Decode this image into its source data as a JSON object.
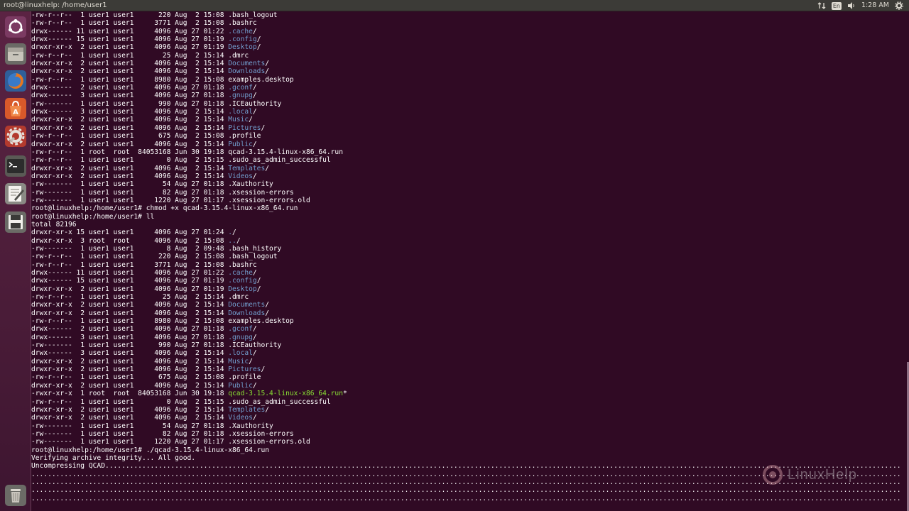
{
  "window": {
    "title": "root@linuxhelp: /home/user1"
  },
  "tray": {
    "language": "En",
    "time": "1:28 AM"
  },
  "launcher": {
    "items": [
      {
        "name": "dash-icon"
      },
      {
        "name": "files-icon"
      },
      {
        "name": "firefox-icon"
      },
      {
        "name": "software-center-icon"
      },
      {
        "name": "settings-icon"
      },
      {
        "name": "terminal-icon"
      },
      {
        "name": "text-editor-icon"
      },
      {
        "name": "save-disk-icon"
      },
      {
        "name": "trash-icon"
      }
    ]
  },
  "terminal": {
    "lines": [
      [
        {
          "t": "-rw-r--r--  1 user1 user1      220 Aug  2 15:08 .bash_logout"
        }
      ],
      [
        {
          "t": "-rw-r--r--  1 user1 user1     3771 Aug  2 15:08 .bashrc"
        }
      ],
      [
        {
          "t": "drwx------ 11 user1 user1     4096 Aug 27 01:22 "
        },
        {
          "t": ".cache",
          "c": "dir"
        },
        {
          "t": "/"
        }
      ],
      [
        {
          "t": "drwx------ 15 user1 user1     4096 Aug 27 01:19 "
        },
        {
          "t": ".config",
          "c": "dir"
        },
        {
          "t": "/"
        }
      ],
      [
        {
          "t": "drwxr-xr-x  2 user1 user1     4096 Aug 27 01:19 "
        },
        {
          "t": "Desktop",
          "c": "dir"
        },
        {
          "t": "/"
        }
      ],
      [
        {
          "t": "-rw-r--r--  1 user1 user1       25 Aug  2 15:14 .dmrc"
        }
      ],
      [
        {
          "t": "drwxr-xr-x  2 user1 user1     4096 Aug  2 15:14 "
        },
        {
          "t": "Documents",
          "c": "dir"
        },
        {
          "t": "/"
        }
      ],
      [
        {
          "t": "drwxr-xr-x  2 user1 user1     4096 Aug  2 15:14 "
        },
        {
          "t": "Downloads",
          "c": "dir"
        },
        {
          "t": "/"
        }
      ],
      [
        {
          "t": "-rw-r--r--  1 user1 user1     8980 Aug  2 15:08 examples.desktop"
        }
      ],
      [
        {
          "t": "drwx------  2 user1 user1     4096 Aug 27 01:18 "
        },
        {
          "t": ".gconf",
          "c": "dir"
        },
        {
          "t": "/"
        }
      ],
      [
        {
          "t": "drwx------  3 user1 user1     4096 Aug 27 01:18 "
        },
        {
          "t": ".gnupg",
          "c": "dir"
        },
        {
          "t": "/"
        }
      ],
      [
        {
          "t": "-rw-------  1 user1 user1      990 Aug 27 01:18 .ICEauthority"
        }
      ],
      [
        {
          "t": "drwx------  3 user1 user1     4096 Aug  2 15:14 "
        },
        {
          "t": ".local",
          "c": "dir"
        },
        {
          "t": "/"
        }
      ],
      [
        {
          "t": "drwxr-xr-x  2 user1 user1     4096 Aug  2 15:14 "
        },
        {
          "t": "Music",
          "c": "dir"
        },
        {
          "t": "/"
        }
      ],
      [
        {
          "t": "drwxr-xr-x  2 user1 user1     4096 Aug  2 15:14 "
        },
        {
          "t": "Pictures",
          "c": "dir"
        },
        {
          "t": "/"
        }
      ],
      [
        {
          "t": "-rw-r--r--  1 user1 user1      675 Aug  2 15:08 .profile"
        }
      ],
      [
        {
          "t": "drwxr-xr-x  2 user1 user1     4096 Aug  2 15:14 "
        },
        {
          "t": "Public",
          "c": "dir"
        },
        {
          "t": "/"
        }
      ],
      [
        {
          "t": "-rw-r--r--  1 root  root  84053168 Jun 30 19:18 qcad-3.15.4-linux-x86_64.run"
        }
      ],
      [
        {
          "t": "-rw-r--r--  1 user1 user1        0 Aug  2 15:15 .sudo_as_admin_successful"
        }
      ],
      [
        {
          "t": "drwxr-xr-x  2 user1 user1     4096 Aug  2 15:14 "
        },
        {
          "t": "Templates",
          "c": "dir"
        },
        {
          "t": "/"
        }
      ],
      [
        {
          "t": "drwxr-xr-x  2 user1 user1     4096 Aug  2 15:14 "
        },
        {
          "t": "Videos",
          "c": "dir"
        },
        {
          "t": "/"
        }
      ],
      [
        {
          "t": "-rw-------  1 user1 user1       54 Aug 27 01:18 .Xauthority"
        }
      ],
      [
        {
          "t": "-rw-------  1 user1 user1       82 Aug 27 01:18 .xsession-errors"
        }
      ],
      [
        {
          "t": "-rw-------  1 user1 user1     1220 Aug 27 01:17 .xsession-errors.old"
        }
      ],
      [
        {
          "t": "root@linuxhelp:/home/user1# chmod +x qcad-3.15.4-linux-x86_64.run"
        }
      ],
      [
        {
          "t": "root@linuxhelp:/home/user1# ll"
        }
      ],
      [
        {
          "t": "total 82196"
        }
      ],
      [
        {
          "t": "drwxr-xr-x 15 user1 user1     4096 Aug 27 01:24 "
        },
        {
          "t": ".",
          "c": "dir"
        },
        {
          "t": "/"
        }
      ],
      [
        {
          "t": "drwxr-xr-x  3 root  root      4096 Aug  2 15:08 "
        },
        {
          "t": "..",
          "c": "dir"
        },
        {
          "t": "/"
        }
      ],
      [
        {
          "t": "-rw-------  1 user1 user1        8 Aug  2 09:48 .bash_history"
        }
      ],
      [
        {
          "t": "-rw-r--r--  1 user1 user1      220 Aug  2 15:08 .bash_logout"
        }
      ],
      [
        {
          "t": "-rw-r--r--  1 user1 user1     3771 Aug  2 15:08 .bashrc"
        }
      ],
      [
        {
          "t": "drwx------ 11 user1 user1     4096 Aug 27 01:22 "
        },
        {
          "t": ".cache",
          "c": "dir"
        },
        {
          "t": "/"
        }
      ],
      [
        {
          "t": "drwx------ 15 user1 user1     4096 Aug 27 01:19 "
        },
        {
          "t": ".config",
          "c": "dir"
        },
        {
          "t": "/"
        }
      ],
      [
        {
          "t": "drwxr-xr-x  2 user1 user1     4096 Aug 27 01:19 "
        },
        {
          "t": "Desktop",
          "c": "dir"
        },
        {
          "t": "/"
        }
      ],
      [
        {
          "t": "-rw-r--r--  1 user1 user1       25 Aug  2 15:14 .dmrc"
        }
      ],
      [
        {
          "t": "drwxr-xr-x  2 user1 user1     4096 Aug  2 15:14 "
        },
        {
          "t": "Documents",
          "c": "dir"
        },
        {
          "t": "/"
        }
      ],
      [
        {
          "t": "drwxr-xr-x  2 user1 user1     4096 Aug  2 15:14 "
        },
        {
          "t": "Downloads",
          "c": "dir"
        },
        {
          "t": "/"
        }
      ],
      [
        {
          "t": "-rw-r--r--  1 user1 user1     8980 Aug  2 15:08 examples.desktop"
        }
      ],
      [
        {
          "t": "drwx------  2 user1 user1     4096 Aug 27 01:18 "
        },
        {
          "t": ".gconf",
          "c": "dir"
        },
        {
          "t": "/"
        }
      ],
      [
        {
          "t": "drwx------  3 user1 user1     4096 Aug 27 01:18 "
        },
        {
          "t": ".gnupg",
          "c": "dir"
        },
        {
          "t": "/"
        }
      ],
      [
        {
          "t": "-rw-------  1 user1 user1      990 Aug 27 01:18 .ICEauthority"
        }
      ],
      [
        {
          "t": "drwx------  3 user1 user1     4096 Aug  2 15:14 "
        },
        {
          "t": ".local",
          "c": "dir"
        },
        {
          "t": "/"
        }
      ],
      [
        {
          "t": "drwxr-xr-x  2 user1 user1     4096 Aug  2 15:14 "
        },
        {
          "t": "Music",
          "c": "dir"
        },
        {
          "t": "/"
        }
      ],
      [
        {
          "t": "drwxr-xr-x  2 user1 user1     4096 Aug  2 15:14 "
        },
        {
          "t": "Pictures",
          "c": "dir"
        },
        {
          "t": "/"
        }
      ],
      [
        {
          "t": "-rw-r--r--  1 user1 user1      675 Aug  2 15:08 .profile"
        }
      ],
      [
        {
          "t": "drwxr-xr-x  2 user1 user1     4096 Aug  2 15:14 "
        },
        {
          "t": "Public",
          "c": "dir"
        },
        {
          "t": "/"
        }
      ],
      [
        {
          "t": "-rwxr-xr-x  1 root  root  84053168 Jun 30 19:18 "
        },
        {
          "t": "qcad-3.15.4-linux-x86_64.run",
          "c": "exec"
        },
        {
          "t": "*"
        }
      ],
      [
        {
          "t": "-rw-r--r--  1 user1 user1        0 Aug  2 15:15 .sudo_as_admin_successful"
        }
      ],
      [
        {
          "t": "drwxr-xr-x  2 user1 user1     4096 Aug  2 15:14 "
        },
        {
          "t": "Templates",
          "c": "dir"
        },
        {
          "t": "/"
        }
      ],
      [
        {
          "t": "drwxr-xr-x  2 user1 user1     4096 Aug  2 15:14 "
        },
        {
          "t": "Videos",
          "c": "dir"
        },
        {
          "t": "/"
        }
      ],
      [
        {
          "t": "-rw-------  1 user1 user1       54 Aug 27 01:18 .Xauthority"
        }
      ],
      [
        {
          "t": "-rw-------  1 user1 user1       82 Aug 27 01:18 .xsession-errors"
        }
      ],
      [
        {
          "t": "-rw-------  1 user1 user1     1220 Aug 27 01:17 .xsession-errors.old"
        }
      ],
      [
        {
          "t": "root@linuxhelp:/home/user1# ./qcad-3.15.4-linux-x86_64.run"
        }
      ],
      [
        {
          "t": "Verifying archive integrity... All good."
        }
      ],
      [
        {
          "t": "Uncompressing QCAD..............................................................................................................................................................................................................."
        }
      ],
      [
        {
          "t": "..................................................................................................................................................................................................................................."
        }
      ],
      [
        {
          "t": "..................................................................................................................................................................................................................................."
        }
      ],
      [
        {
          "t": "..................................................................................................................................................................................................................................."
        }
      ],
      [
        {
          "t": "..................................................................................................................................................................................................................................."
        }
      ]
    ]
  },
  "watermark": {
    "text": "LinuxHelp"
  },
  "colors": {
    "background": "#300a24",
    "directory": "#729fcf",
    "executable": "#8ae234",
    "panel": "#3c3b37"
  }
}
